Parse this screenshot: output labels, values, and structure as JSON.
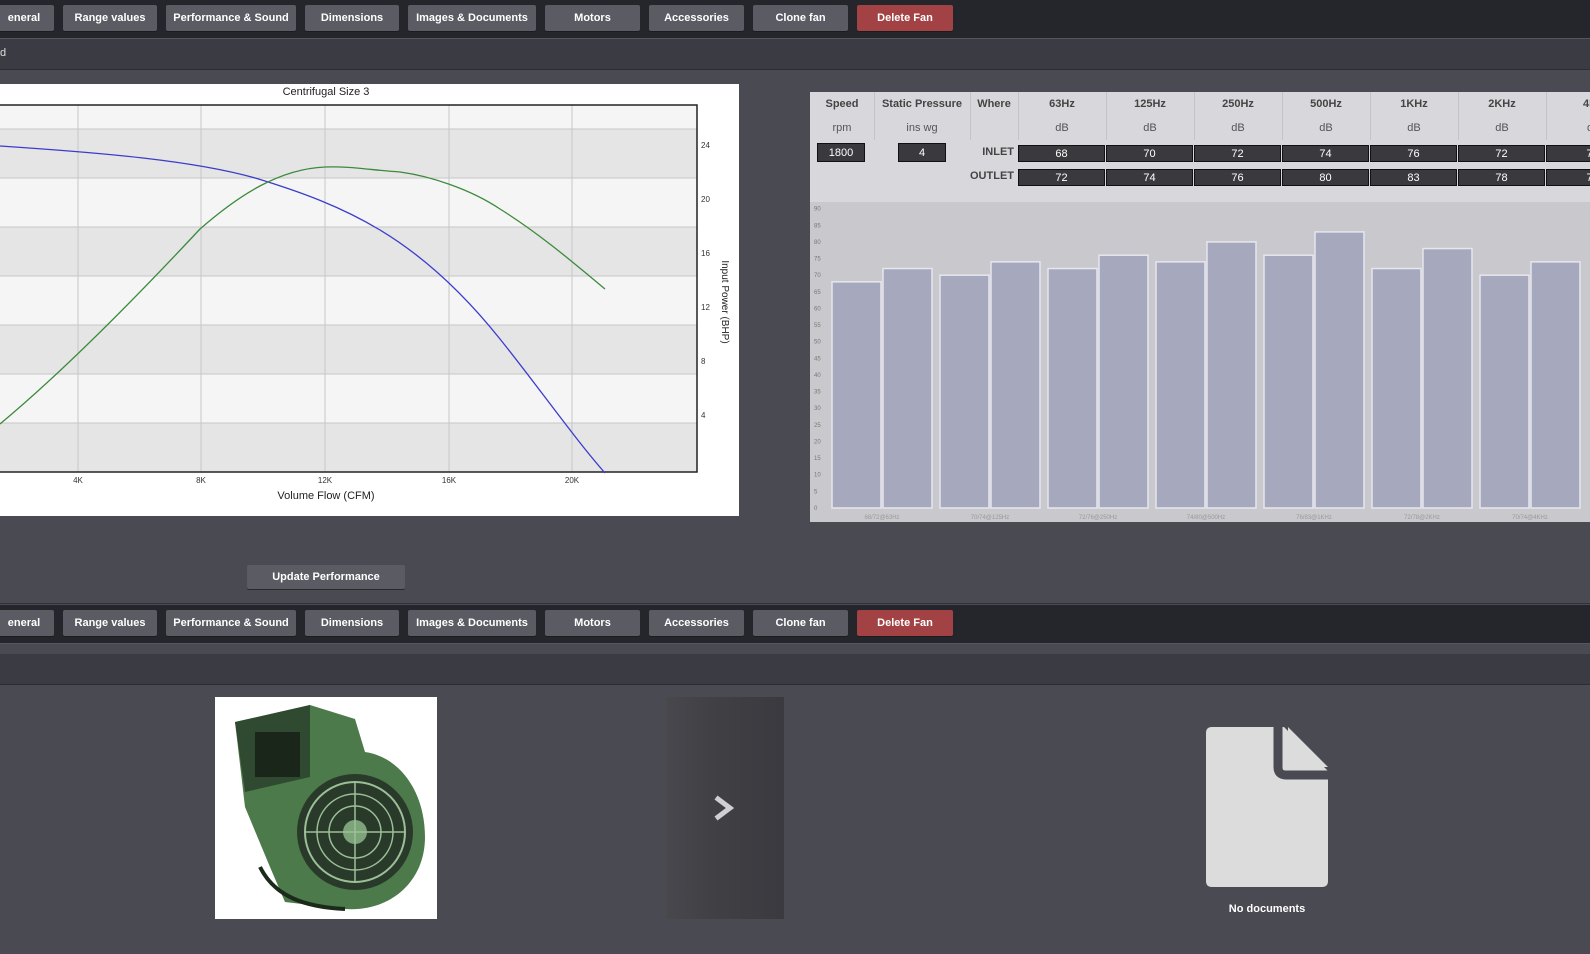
{
  "tabs": [
    "eneral",
    "Range values",
    "Performance & Sound",
    "Dimensions",
    "Images & Documents",
    "Motors",
    "Accessories",
    "Clone fan",
    "Delete Fan"
  ],
  "subbar_text": "d",
  "performance_chart": {
    "title": "Centrifugal Size 3",
    "xlabel": "Volume Flow (CFM)",
    "y2label": "Input Power (BHP)",
    "x_ticks": [
      "4K",
      "8K",
      "12K",
      "16K",
      "20K"
    ],
    "y2_ticks": [
      "4",
      "8",
      "12",
      "16",
      "20",
      "24"
    ],
    "colors": {
      "pressure": "#3c3ccc",
      "power": "#3c8a3c"
    }
  },
  "update_button": "Update Performance",
  "sound_table": {
    "headers": [
      "Speed",
      "Static Pressure",
      "Where",
      "63Hz",
      "125Hz",
      "250Hz",
      "500Hz",
      "1KHz",
      "2KHz",
      "4K"
    ],
    "units": [
      "rpm",
      "ins wg",
      "",
      "dB",
      "dB",
      "dB",
      "dB",
      "dB",
      "dB",
      "d"
    ],
    "speed": "1800",
    "static_pressure": "4",
    "inlet_label": "INLET",
    "outlet_label": "OUTLET",
    "inlet": [
      "68",
      "70",
      "72",
      "74",
      "76",
      "72",
      "7"
    ],
    "outlet": [
      "72",
      "74",
      "76",
      "80",
      "83",
      "78",
      "7"
    ]
  },
  "chart_data": {
    "type": "bar",
    "categories": [
      "63Hz",
      "125Hz",
      "250Hz",
      "500Hz",
      "1KHz",
      "2KHz",
      "4KHz"
    ],
    "series": [
      {
        "name": "INLET",
        "values": [
          68,
          70,
          72,
          74,
          76,
          72,
          70
        ]
      },
      {
        "name": "OUTLET",
        "values": [
          72,
          74,
          76,
          80,
          83,
          78,
          74
        ]
      }
    ],
    "category_labels": [
      "68/72@63Hz",
      "70/74@125Hz",
      "72/76@250Hz",
      "74/80@500Hz",
      "76/83@1KHz",
      "72/78@2KHz",
      "70/74@4KHz"
    ],
    "y_ticks": [
      "0",
      "5",
      "10",
      "15",
      "20",
      "25",
      "30",
      "35",
      "40",
      "45",
      "50",
      "55",
      "60",
      "65",
      "70",
      "75",
      "80",
      "85",
      "90"
    ],
    "ylim": [
      0,
      92
    ],
    "bar_color": "#a6a9bd"
  },
  "no_documents": "No documents"
}
